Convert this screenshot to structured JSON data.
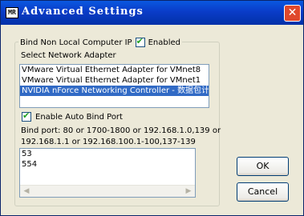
{
  "window": {
    "title": "Advanced Settings",
    "app_icon_text": "MR",
    "close_glyph": "✕"
  },
  "group": {
    "label": "Bind Non Local Computer IP",
    "enabled_label": "Enabled",
    "enabled_checked": true
  },
  "adapter": {
    "label": "Select Network Adapter",
    "items": [
      "VMware Virtual Ethernet Adapter for VMnet8",
      "VMware Virtual Ethernet Adapter for VMnet1",
      "NVIDIA nForce Networking Controller - 数据包计"
    ],
    "selected_index": 2
  },
  "auto_bind": {
    "label": "Enable Auto Bind Port",
    "checked": true
  },
  "bind_info": {
    "line1": "Bind port: 80 or 1700-1800 or 192.168.1.0,139 or",
    "line2": "192.168.1.1 or 192.168.100.1-100,137-139"
  },
  "ports": [
    "53",
    "554"
  ],
  "buttons": {
    "ok": "OK",
    "cancel": "Cancel"
  },
  "colors": {
    "title_bar": "#0a46d8",
    "selection": "#316ac5",
    "close_button": "#e0482c",
    "checkmark": "#21a121"
  }
}
